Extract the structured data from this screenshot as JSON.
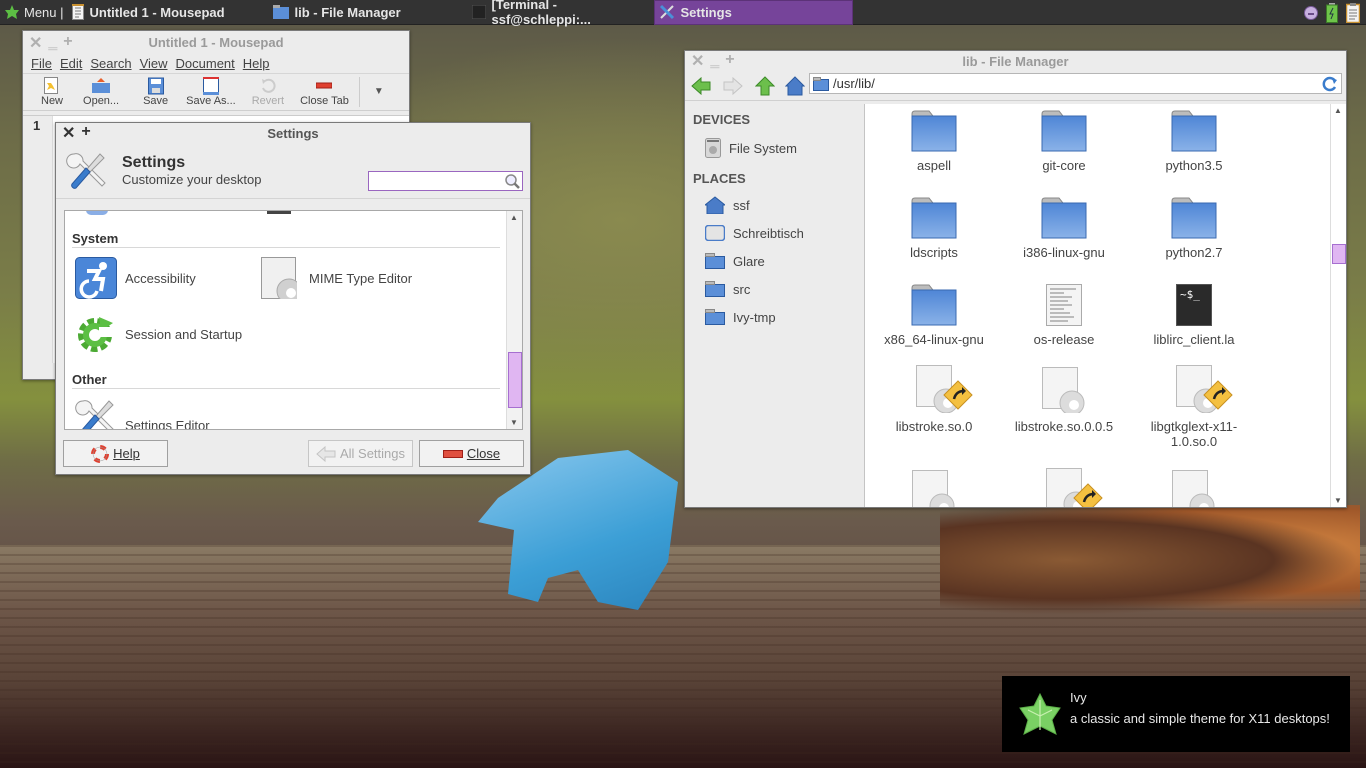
{
  "taskbar": {
    "menu_label": "Menu |",
    "tasks": [
      {
        "label": "Untitled 1 - Mousepad",
        "icon": "text-editor-icon",
        "active": false
      },
      {
        "label": "lib - File Manager",
        "icon": "folder-icon",
        "active": false
      },
      {
        "label": "[Terminal - ssf@schleppi:...",
        "icon": "terminal-icon",
        "active": false
      },
      {
        "label": "Settings",
        "icon": "settings-icon",
        "active": true
      }
    ],
    "tray": [
      "emoji-indicator-icon",
      "battery-icon",
      "clipboard-icon"
    ],
    "accent_color": "#76449a"
  },
  "mousepad": {
    "title": "Untitled 1 - Mousepad",
    "menu": [
      "File",
      "Edit",
      "Search",
      "View",
      "Document",
      "Help"
    ],
    "toolbar": [
      {
        "label": "New",
        "icon": "new-document-icon",
        "enabled": true
      },
      {
        "label": "Open...",
        "icon": "open-icon",
        "enabled": true
      },
      {
        "label": "Save",
        "icon": "save-icon",
        "enabled": true
      },
      {
        "label": "Save As...",
        "icon": "save-as-icon",
        "enabled": true
      },
      {
        "label": "Revert",
        "icon": "revert-icon",
        "enabled": false
      },
      {
        "label": "Close Tab",
        "icon": "close-tab-icon",
        "enabled": true
      }
    ],
    "line_number": "1"
  },
  "settings": {
    "window_title": "Settings",
    "header_title": "Settings",
    "header_subtitle": "Customize your desktop",
    "search_value": "",
    "sections": [
      {
        "title": "System",
        "items": [
          "Accessibility",
          "MIME Type Editor",
          "Session and Startup"
        ]
      },
      {
        "title": "Other",
        "items": [
          "Settings Editor"
        ]
      }
    ],
    "buttons": {
      "help": "Help",
      "all_settings": "All Settings",
      "close": "Close"
    }
  },
  "file_manager": {
    "window_title": "lib - File Manager",
    "path": "/usr/lib/",
    "sidebar": {
      "devices_header": "DEVICES",
      "devices": [
        "File System"
      ],
      "places_header": "PLACES",
      "places": [
        "ssf",
        "Schreibtisch",
        "Glare",
        "src",
        "Ivy-tmp"
      ]
    },
    "files": [
      {
        "name": "aspell",
        "type": "folder"
      },
      {
        "name": "git-core",
        "type": "folder"
      },
      {
        "name": "python3.5",
        "type": "folder"
      },
      {
        "name": "ldscripts",
        "type": "folder"
      },
      {
        "name": "i386-linux-gnu",
        "type": "folder"
      },
      {
        "name": "python2.7",
        "type": "folder"
      },
      {
        "name": "x86_64-linux-gnu",
        "type": "folder"
      },
      {
        "name": "os-release",
        "type": "text"
      },
      {
        "name": "liblirc_client.la",
        "type": "script"
      },
      {
        "name": "libstroke.so.0",
        "type": "library-link"
      },
      {
        "name": "libstroke.so.0.0.5",
        "type": "library"
      },
      {
        "name": "libgtkglext-x11-1.0.so.0",
        "type": "library-link"
      },
      {
        "name": "",
        "type": "library"
      },
      {
        "name": "",
        "type": "library-link"
      },
      {
        "name": "",
        "type": "library"
      }
    ]
  },
  "notification": {
    "title": "Ivy",
    "body": "a classic and simple theme for X11 desktops!"
  }
}
